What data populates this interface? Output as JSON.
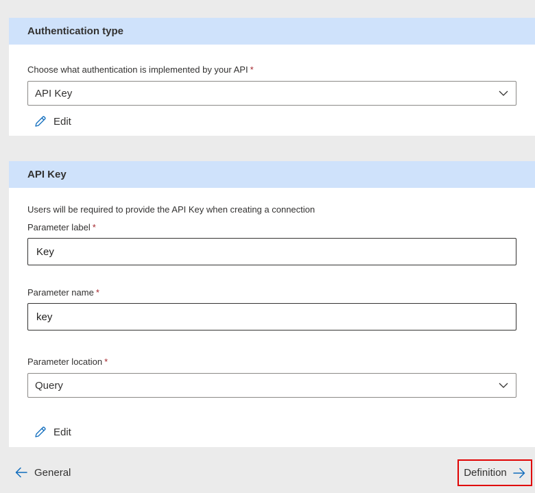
{
  "auth_section": {
    "title": "Authentication type",
    "question_label": "Choose what authentication is implemented by your API",
    "required_mark": "*",
    "selected_type": "API Key",
    "edit_label": "Edit"
  },
  "api_key_section": {
    "title": "API Key",
    "description": "Users will be required to provide the API Key when creating a connection",
    "parameter_label": {
      "label": "Parameter label",
      "required_mark": "*",
      "value": "Key"
    },
    "parameter_name": {
      "label": "Parameter name",
      "required_mark": "*",
      "value": "key"
    },
    "parameter_location": {
      "label": "Parameter location",
      "required_mark": "*",
      "value": "Query"
    },
    "edit_label": "Edit"
  },
  "footer": {
    "back_label": "General",
    "next_label": "Definition"
  },
  "colors": {
    "section_header_bg": "#cfe2fb",
    "page_bg": "#ebebeb",
    "required": "#a4262c",
    "accent": "#0f6cbd",
    "highlight_border": "#e00000"
  }
}
